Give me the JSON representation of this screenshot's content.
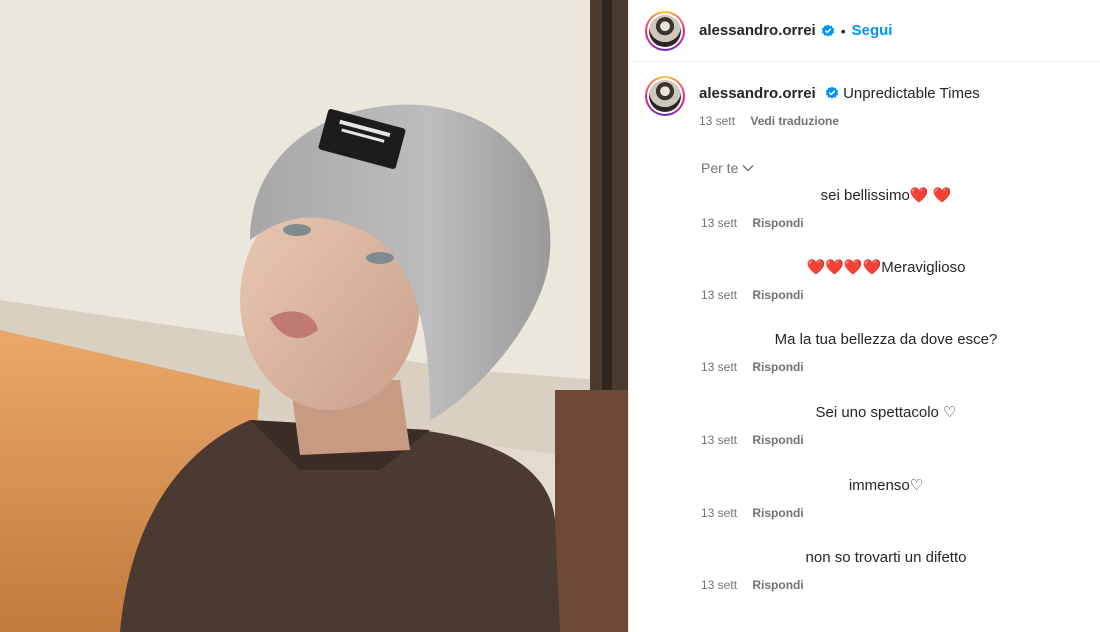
{
  "post": {
    "username": "alessandro.orrei",
    "separator": "•",
    "follow_label": "Segui"
  },
  "caption": {
    "username": "alessandro.orrei",
    "text": "Unpredictable Times",
    "time": "13 sett",
    "translate_label": "Vedi traduzione"
  },
  "sort": {
    "label": "Per te"
  },
  "comments": [
    {
      "text": "sei bellissimo❤️ ❤️",
      "time": "13 sett",
      "reply_label": "Rispondi"
    },
    {
      "text": "❤️❤️❤️❤️Meraviglioso",
      "time": "13 sett",
      "reply_label": "Rispondi"
    },
    {
      "text": "Ma la tua bellezza da dove esce?",
      "time": "13 sett",
      "reply_label": "Rispondi"
    },
    {
      "text": "Sei uno spettacolo ♡",
      "time": "13 sett",
      "reply_label": "Rispondi"
    },
    {
      "text": "immenso♡",
      "time": "13 sett",
      "reply_label": "Rispondi"
    },
    {
      "text": "non so trovarti un difetto",
      "time": "13 sett",
      "reply_label": "Rispondi"
    }
  ],
  "icons": {
    "verified": "verified-badge-icon",
    "chevron": "chevron-down-icon"
  },
  "colors": {
    "accent": "#0095f6",
    "secondary_text": "#737373"
  }
}
